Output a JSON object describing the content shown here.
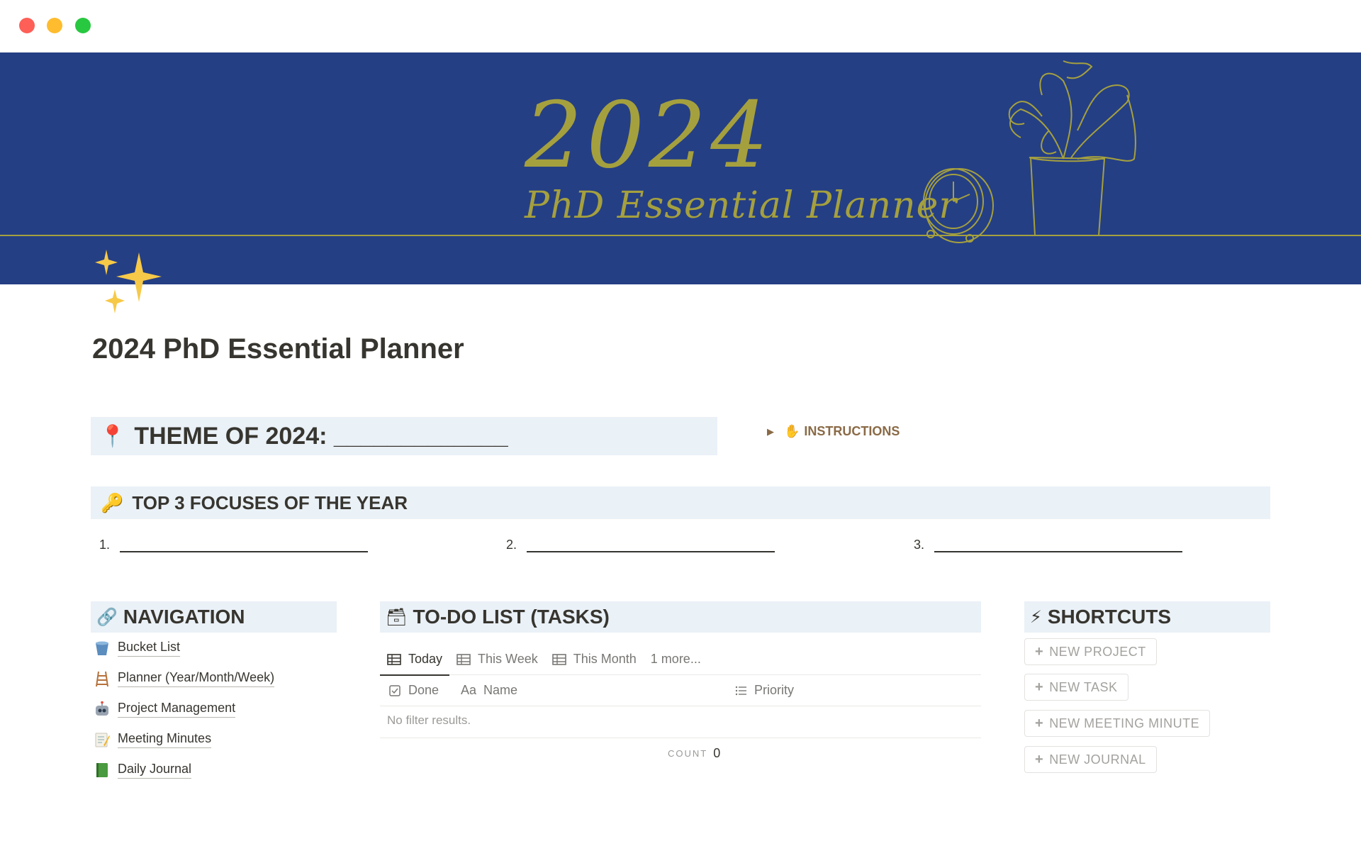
{
  "window": {
    "controls": [
      "close",
      "minimize",
      "maximize"
    ]
  },
  "cover": {
    "title_year": "2024",
    "title_sub": "PhD Essential Planner",
    "background": "#253f84",
    "accent": "#a5a03e"
  },
  "page": {
    "icon": "sparkles-icon",
    "title": "2024 PhD Essential Planner"
  },
  "theme": {
    "emoji": "📍",
    "text": "THEME OF 2024: _____________"
  },
  "instructions": {
    "emoji": "✋",
    "label": "INSTRUCTIONS"
  },
  "focuses": {
    "emoji": "🔑",
    "title": "TOP 3 FOCUSES OF THE YEAR",
    "items": [
      {
        "num": "1."
      },
      {
        "num": "2."
      },
      {
        "num": "3."
      }
    ]
  },
  "navigation": {
    "emoji": "🔗",
    "title": "NAVIGATION",
    "items": [
      {
        "label": "Bucket List",
        "icon": "bucket-icon"
      },
      {
        "label": "Planner (Year/Month/Week)",
        "icon": "ladder-icon"
      },
      {
        "label": "Project Management",
        "icon": "robot-icon"
      },
      {
        "label": "Meeting Minutes",
        "icon": "memo-icon"
      },
      {
        "label": "Daily Journal",
        "icon": "green-book-icon"
      }
    ]
  },
  "todo": {
    "emoji": "🗃",
    "title": "TO-DO LIST (TASKS)",
    "tabs": [
      {
        "label": "Today",
        "active": true
      },
      {
        "label": "This Week",
        "active": false
      },
      {
        "label": "This Month",
        "active": false
      },
      {
        "label": "1 more...",
        "active": false
      }
    ],
    "columns": [
      {
        "label": "Done",
        "icon": "checkbox-icon"
      },
      {
        "label": "Name",
        "icon": "text-icon",
        "icon_text": "Aa"
      },
      {
        "label": "Priority",
        "icon": "list-icon"
      }
    ],
    "empty_text": "No filter results.",
    "count_label": "COUNT",
    "count_value": "0"
  },
  "shortcuts": {
    "emoji": "⚡",
    "title": "SHORTCUTS",
    "buttons": [
      {
        "label": "NEW PROJECT"
      },
      {
        "label": "NEW TASK"
      },
      {
        "label": "NEW MEETING MINUTE"
      },
      {
        "label": "NEW JOURNAL"
      }
    ],
    "plus": "+"
  }
}
